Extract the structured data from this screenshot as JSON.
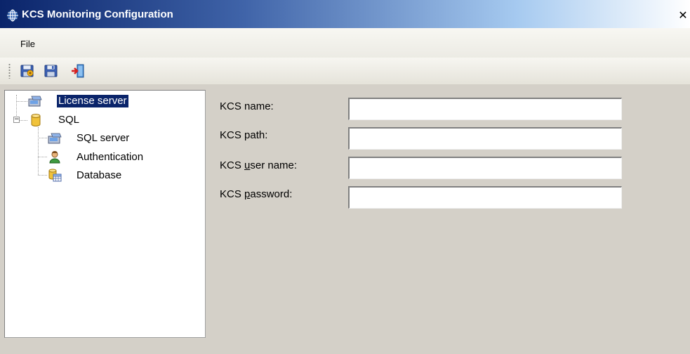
{
  "window": {
    "title": "KCS Monitoring Configuration",
    "close_glyph": "✕"
  },
  "menu": {
    "items": [
      {
        "label": "File"
      }
    ]
  },
  "toolbar": {
    "buttons": [
      {
        "icon": "save-load-icon"
      },
      {
        "icon": "save-icon"
      },
      {
        "icon": "exit-icon"
      }
    ]
  },
  "tree": {
    "nodes": [
      {
        "label": "License server",
        "icon": "server-computer-icon",
        "selected": true
      },
      {
        "label": "SQL",
        "icon": "database-cylinder-icon",
        "expanded": true,
        "expander": "−"
      },
      {
        "label": "SQL server",
        "icon": "server-computer-icon"
      },
      {
        "label": "Authentication",
        "icon": "user-icon"
      },
      {
        "label": "Database",
        "icon": "database-table-icon"
      }
    ]
  },
  "form": {
    "fields": [
      {
        "label": "KCS name:",
        "value": ""
      },
      {
        "label": "KCS path:",
        "value": ""
      },
      {
        "label_pre": "KCS ",
        "label_mnemonic": "u",
        "label_post": "ser name:",
        "value": ""
      },
      {
        "label_pre": "KCS ",
        "label_mnemonic": "p",
        "label_post": "assword:",
        "value": ""
      }
    ]
  },
  "colors": {
    "title_gradient_start": "#0a246a",
    "title_gradient_end": "#ffffff",
    "selection": "#0a246a",
    "window_bg": "#d4d0c8"
  }
}
